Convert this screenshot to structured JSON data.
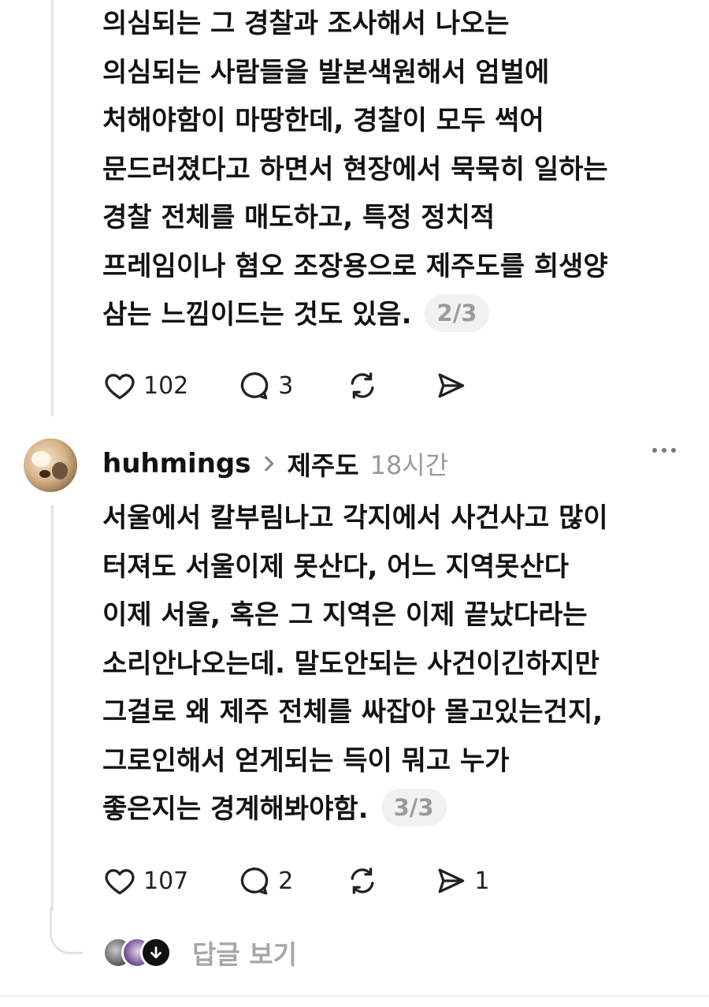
{
  "post1": {
    "lines": [
      "의심되는 그 경찰과 조사해서 나오는",
      "의심되는 사람들을 발본색원해서 엄벌에",
      "처해야함이 마땅한데, 경찰이 모두 썩어",
      "문드러졌다고 하면서 현장에서 묵묵히 일하는",
      "경찰 전체를 매도하고, 특정 정치적",
      "프레임이나 혐오 조장용으로 제주도를 희생양",
      "삼는 느낌이드는 것도 있음."
    ],
    "counter": "2/3",
    "likes": "102",
    "comments": "3",
    "reposts": "",
    "shares": ""
  },
  "post2": {
    "username": "huhmings",
    "topic": "제주도",
    "time": "18시간",
    "lines": [
      "서울에서 칼부림나고 각지에서 사건사고 많이",
      "터져도 서울이제 못산다, 어느 지역못산다",
      "이제 서울, 혹은 그 지역은 이제 끝났다라는",
      "소리안나오는데. 말도안되는 사건이긴하지만",
      "그걸로 왜 제주 전체를 싸잡아 몰고있는건지,",
      "그로인해서 얻게되는 득이 뭐고 누가",
      "좋은지는 경계해봐야함."
    ],
    "counter": "3/3",
    "likes": "107",
    "comments": "2",
    "reposts": "",
    "shares": "1"
  },
  "replies": {
    "label": "답글 보기"
  },
  "icons": {
    "like": "heart-icon",
    "comment": "comment-bubble-icon",
    "repost": "repost-icon",
    "share": "send-icon",
    "more": "more-horizontal-icon",
    "chevron": "chevron-right-icon",
    "down": "arrow-down-icon"
  }
}
